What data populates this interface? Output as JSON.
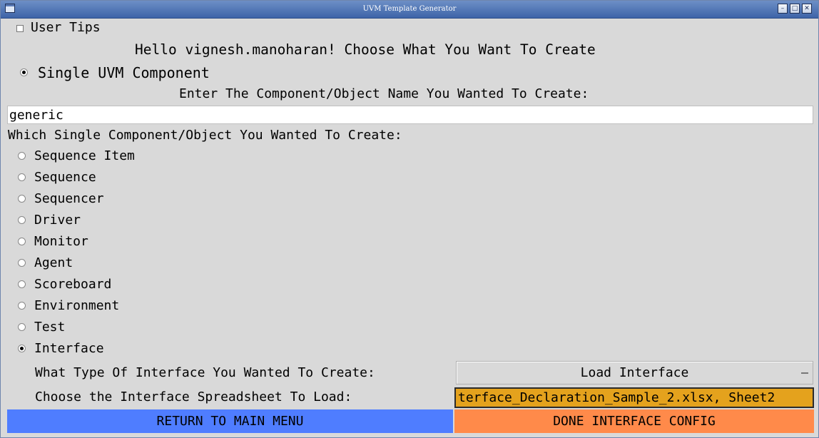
{
  "window": {
    "title": "UVM Template Generator"
  },
  "user_tips": {
    "label": "User Tips",
    "checked": false
  },
  "greeting": "Hello vignesh.manoharan! Choose What You Want To Create",
  "mode": {
    "label": "Single UVM Component",
    "selected": true
  },
  "name_prompt": "Enter The Component/Object Name You Wanted To Create:",
  "name_value": "generic",
  "which_prompt": "Which Single Component/Object You Wanted To Create:",
  "options": [
    {
      "label": "Sequence Item",
      "selected": false
    },
    {
      "label": "Sequence",
      "selected": false
    },
    {
      "label": "Sequencer",
      "selected": false
    },
    {
      "label": "Driver",
      "selected": false
    },
    {
      "label": "Monitor",
      "selected": false
    },
    {
      "label": "Agent",
      "selected": false
    },
    {
      "label": "Scoreboard",
      "selected": false
    },
    {
      "label": "Environment",
      "selected": false
    },
    {
      "label": "Test",
      "selected": false
    },
    {
      "label": "Interface",
      "selected": true
    }
  ],
  "interface": {
    "type_prompt": "What Type Of Interface You Wanted To Create:",
    "type_value": "Load Interface",
    "sheet_prompt": "Choose the Interface Spreadsheet To Load:",
    "sheet_value": "terface_Declaration_Sample_2.xlsx, Sheet2"
  },
  "buttons": {
    "return": "RETURN TO MAIN MENU",
    "done": "DONE INTERFACE CONFIG"
  },
  "colors": {
    "return_bg": "#4f7dff",
    "done_bg": "#ff8a4a",
    "file_bg": "#e4a21d",
    "titlebar": "#4f72b4"
  }
}
